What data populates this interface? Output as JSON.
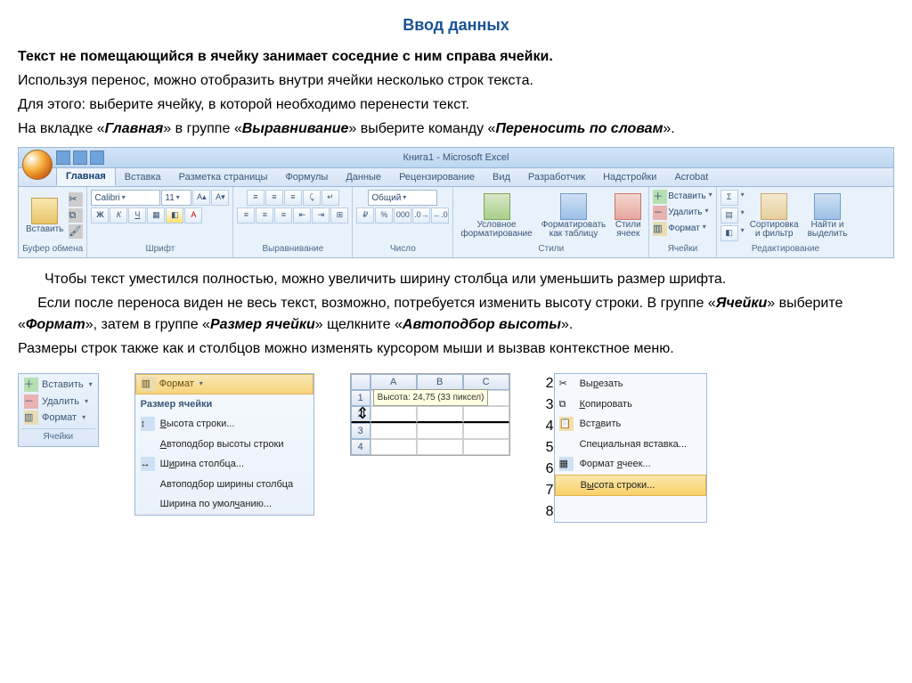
{
  "title": "Ввод данных",
  "p1": "Текст не помещающийся в ячейку занимает соседние с ним справа ячейки.",
  "p2": "Используя перенос, можно отобразить внутри ячейки несколько строк текста.",
  "p3": "Для этого: выберите ячейку, в которой необходимо перенести текст.",
  "p4a": "На вкладке «",
  "p4b": "Главная",
  "p4c": "» в группе «",
  "p4d": "Выравнивание",
  "p4e": "» выберите команду «",
  "p4f": "Переносить по словам",
  "p4g": "».",
  "p5": "Чтобы текст уместился полностью, можно увеличить ширину столбца или уменьшить размер шрифта.",
  "p6a": "Если после переноса виден не весь текст, возможно, потребуется изменить высоту строки. В группе «",
  "p6b": "Ячейки",
  "p6c": "» выберите «",
  "p6d": "Формат",
  "p6e": "», затем в группе «",
  "p6f": "Размер ячейки",
  "p6g": "» щелкните «",
  "p6h": "Автоподбор высоты",
  "p6i": "».",
  "p7": "Размеры строк также как и столбцов можно изменять курсором мыши и вызвав контекстное меню.",
  "ribbon": {
    "window_title": "Книга1 - Microsoft Excel",
    "tabs": [
      "Главная",
      "Вставка",
      "Разметка страницы",
      "Формулы",
      "Данные",
      "Рецензирование",
      "Вид",
      "Разработчик",
      "Надстройки",
      "Acrobat"
    ],
    "groups": {
      "clipboard": {
        "name": "Буфер обмена",
        "paste": "Вставить"
      },
      "font": {
        "name": "Шрифт",
        "family": "Calibri",
        "size": "11",
        "b": "Ж",
        "i": "К",
        "u": "Ч"
      },
      "align": {
        "name": "Выравнивание"
      },
      "number": {
        "name": "Число",
        "format": "Общий"
      },
      "styles": {
        "name": "Стили",
        "cond": "Условное",
        "cond2": "форматирование",
        "table": "Форматировать",
        "table2": "как таблицу",
        "cell": "Стили",
        "cell2": "ячеек"
      },
      "cells": {
        "name": "Ячейки",
        "insert": "Вставить",
        "delete": "Удалить",
        "format": "Формат"
      },
      "editing": {
        "name": "Редактирование",
        "sort": "Сортировка",
        "sort2": "и фильтр",
        "find": "Найти и",
        "find2": "выделить"
      }
    }
  },
  "cells_panel": {
    "insert": "Вставить",
    "delete": "Удалить",
    "format": "Формат",
    "footer": "Ячейки"
  },
  "format_menu": {
    "header": "Формат",
    "section": "Размер ячейки",
    "items": [
      "Высота строки...",
      "Автоподбор высоты строки",
      "Ширина столбца...",
      "Автоподбор ширины столбца",
      "Ширина по умолчанию..."
    ]
  },
  "sheet": {
    "cols": [
      "A",
      "B",
      "C"
    ],
    "tooltip": "Высота: 24,75 (33 пиксел)"
  },
  "ctx": {
    "rows": [
      "2",
      "3",
      "4",
      "5",
      "6",
      "7",
      "8"
    ],
    "items": [
      "Вырезать",
      "Копировать",
      "Вставить",
      "Специальная вставка...",
      "Формат ячеек...",
      "Высота строки..."
    ]
  }
}
